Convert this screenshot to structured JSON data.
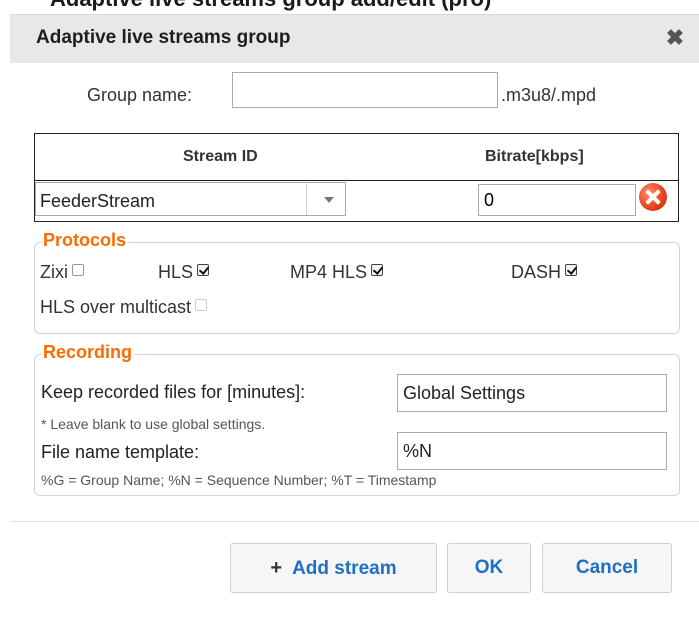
{
  "dialog": {
    "cutoff_text": "Adaptive live streams group add/edit (pro)",
    "title": "Adaptive live streams group",
    "close_glyph": "✖"
  },
  "group": {
    "label": "Group name:",
    "value": "",
    "suffix": ".m3u8/.mpd"
  },
  "streams_table": {
    "headers": {
      "stream_id": "Stream ID",
      "bitrate": "Bitrate[kbps]"
    },
    "rows": [
      {
        "stream_id": "FeederStream",
        "bitrate": "0"
      }
    ]
  },
  "protocols": {
    "legend": "Protocols",
    "items": [
      {
        "label": "Zixi",
        "checked": false
      },
      {
        "label": "HLS",
        "checked": true
      },
      {
        "label": "MP4 HLS",
        "checked": true
      },
      {
        "label": "DASH",
        "checked": true
      },
      {
        "label": "HLS over multicast",
        "checked": false,
        "disabled": true
      }
    ]
  },
  "recording": {
    "legend": "Recording",
    "keep_label": "Keep recorded files for [minutes]:",
    "keep_value": "Global Settings",
    "keep_hint": "* Leave blank to use global settings.",
    "template_label": "File name template:",
    "template_value": "%N",
    "template_hint": "%G = Group Name; %N = Sequence Number; %T = Timestamp"
  },
  "buttons": {
    "add_stream": "Add stream",
    "ok": "OK",
    "cancel": "Cancel"
  },
  "icons": {
    "close": "close-icon",
    "dropdown": "chevron-down-icon",
    "remove": "remove-circle-icon",
    "add": "plus-icon"
  },
  "colors": {
    "legend": "#ff6a00",
    "button_text": "#1f6fc4",
    "remove": "#e8401c"
  }
}
